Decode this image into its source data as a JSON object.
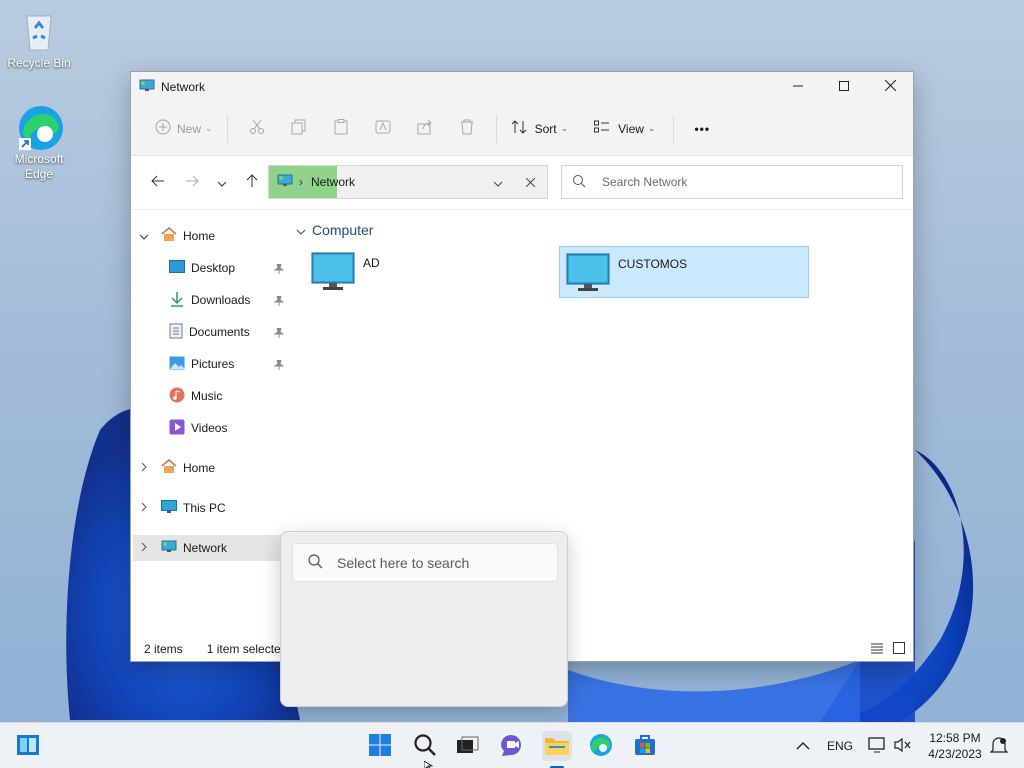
{
  "desktop": {
    "icons": [
      {
        "label": "Recycle Bin"
      },
      {
        "label": "Microsoft Edge"
      }
    ]
  },
  "window": {
    "title": "Network",
    "toolbar": {
      "new_label": "New",
      "sort_label": "Sort",
      "view_label": "View",
      "more_label": "•••"
    },
    "address": {
      "crumb": "Network",
      "separator": "›"
    },
    "search": {
      "placeholder": "Search Network"
    },
    "sidebar": {
      "quick": [
        {
          "label": "Home"
        },
        {
          "label": "Desktop"
        },
        {
          "label": "Downloads"
        },
        {
          "label": "Documents"
        },
        {
          "label": "Pictures"
        },
        {
          "label": "Music"
        },
        {
          "label": "Videos"
        }
      ],
      "roots": [
        {
          "label": "Home"
        },
        {
          "label": "This PC"
        },
        {
          "label": "Network"
        }
      ]
    },
    "content": {
      "group": "Computer",
      "items": [
        {
          "name": "AD"
        },
        {
          "name": "CUSTOMOS"
        }
      ]
    },
    "status": {
      "count": "2 items",
      "selected": "1 item selected"
    }
  },
  "flyout": {
    "placeholder": "Select here to search"
  },
  "taskbar": {
    "lang": "ENG",
    "time": "12:58 PM",
    "date": "4/23/2023"
  },
  "colors": {
    "accent": "#0067c0",
    "selection": "#cce8ff",
    "address_highlight": "#8fd38a"
  }
}
